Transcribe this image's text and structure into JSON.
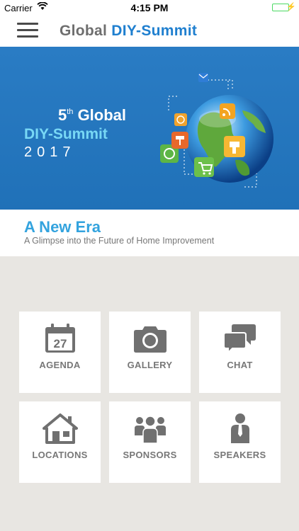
{
  "status_bar": {
    "carrier": "Carrier",
    "time": "4:15 PM"
  },
  "nav": {
    "title_part1": "Global",
    "title_part2": "DIY-Summit",
    "menu_icon": "hamburger-menu-icon"
  },
  "banner": {
    "ordinal": "5",
    "ordinal_suffix": "th",
    "line1": "Global",
    "line2": "DIY-Summit",
    "line3": "2017"
  },
  "tagline": {
    "title": "A New Era",
    "subtitle": "A Glimpse into the Future of Home Improvement"
  },
  "tiles": [
    {
      "label": "AGENDA",
      "icon": "calendar-icon",
      "day": "27"
    },
    {
      "label": "GALLERY",
      "icon": "camera-icon"
    },
    {
      "label": "CHAT",
      "icon": "chat-bubbles-icon"
    },
    {
      "label": "LOCATIONS",
      "icon": "house-icon"
    },
    {
      "label": "SPONSORS",
      "icon": "people-group-icon"
    },
    {
      "label": "SPEAKERS",
      "icon": "speaker-person-icon"
    }
  ],
  "colors": {
    "accent_blue": "#1f7fcf",
    "banner_blue": "#2a7cc4",
    "tagline_blue": "#33a3de",
    "icon_gray": "#707070",
    "background": "#e8e6e2"
  }
}
